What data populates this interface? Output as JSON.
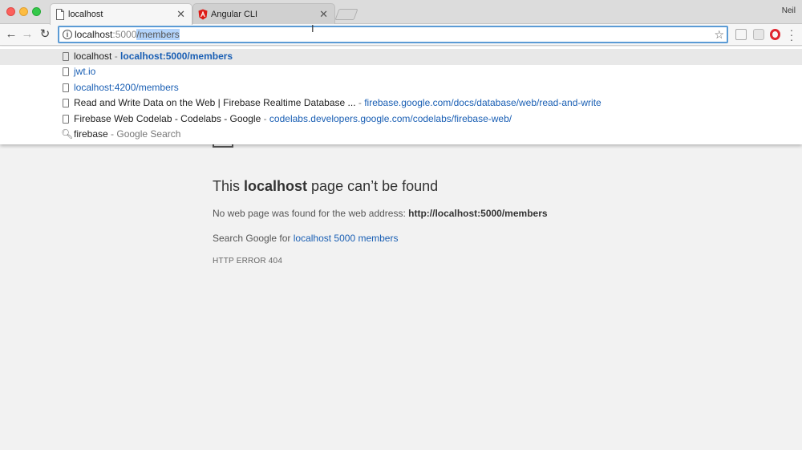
{
  "window": {
    "profile_name": "Neil"
  },
  "tabs": [
    {
      "label": "localhost",
      "icon": "page-icon"
    },
    {
      "label": "Angular CLI",
      "icon": "angular-icon",
      "icon_color": "#dd1b16"
    }
  ],
  "omnibox": {
    "host": "localhost",
    "port": ":5000",
    "path_selected": "/members"
  },
  "suggestions": [
    {
      "title": "localhost",
      "sep": " - ",
      "url": "localhost:5000/members",
      "icon": "page-icon"
    },
    {
      "url": "jwt.io",
      "icon": "page-icon"
    },
    {
      "url": "localhost:4200/members",
      "icon": "page-icon"
    },
    {
      "title": "Read and Write Data on the Web | Firebase Realtime Database ...",
      "sep": " - ",
      "url": "firebase.google.com/docs/database/web/read-and-write",
      "icon": "page-icon"
    },
    {
      "title": "Firebase Web Codelab - Codelabs - Google",
      "sep": " - ",
      "url": "codelabs.developers.google.com/codelabs/firebase-web/",
      "icon": "page-icon"
    },
    {
      "title": "firebase",
      "sep": " - ",
      "hint": "Google Search",
      "icon": "search-icon"
    }
  ],
  "error": {
    "title_pre": "This ",
    "title_host": "localhost",
    "title_post": " page can’t be found",
    "message_pre": "No web page was found for the web address: ",
    "message_url": "http://localhost:5000/members",
    "search_pre": "Search Google for ",
    "search_link": "localhost 5000 members",
    "code": "HTTP ERROR 404"
  },
  "colors": {
    "accent": "#5b9bd5",
    "link": "#1a5fb4",
    "opera": "#e0262f"
  }
}
